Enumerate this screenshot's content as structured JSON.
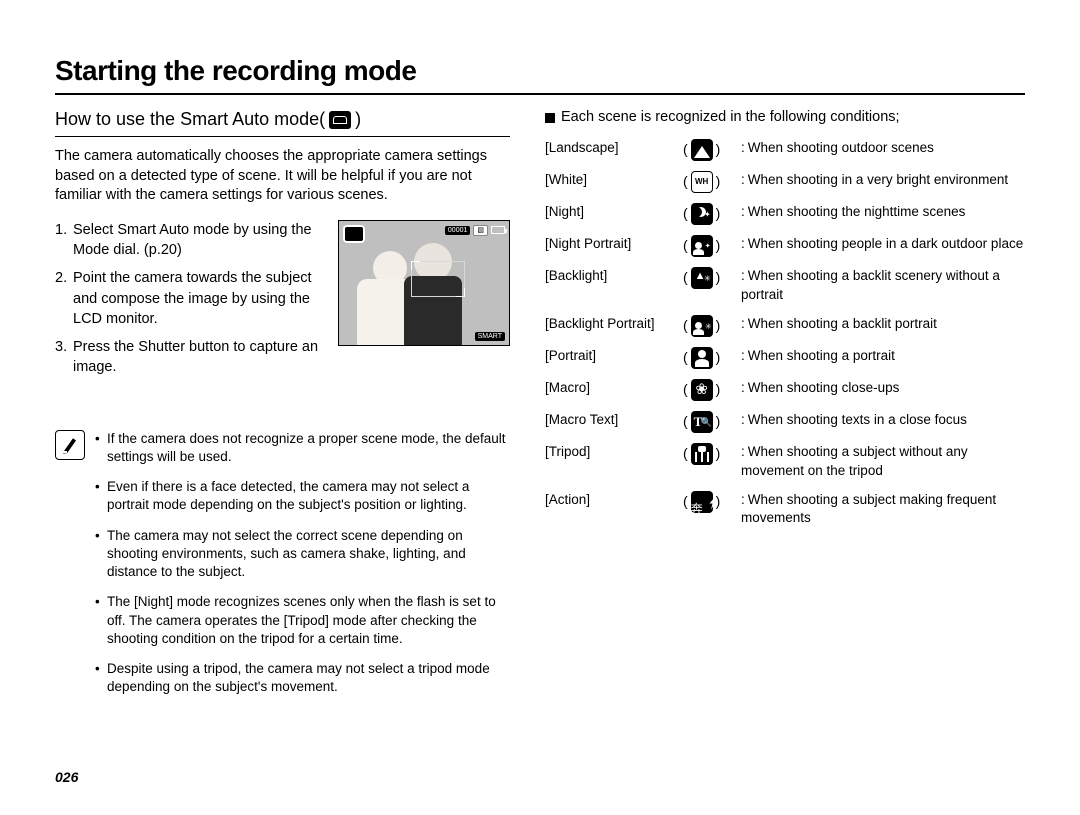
{
  "title": "Starting the recording mode",
  "page_number": "026",
  "left": {
    "subhead_prefix": "How to use the Smart Auto mode(",
    "subhead_suffix": " )",
    "intro": "The camera automatically chooses the appropriate camera settings based on a detected type of scene. It will be helpful if you are not familiar with the camera settings for various scenes.",
    "steps": [
      "Select Smart Auto mode by using the Mode dial. (p.20)",
      "Point the camera towards the subject and compose the image by using the LCD monitor.",
      "Press the Shutter button to capture an image."
    ],
    "osd": {
      "counter": "00001",
      "smart_label": "SMART"
    },
    "notes": [
      "If the camera does not recognize a proper scene mode, the default settings will be used.",
      "Even if there is a face detected, the camera may not select a portrait mode depending on the subject's position or lighting.",
      "The camera may not select the correct scene depending on shooting environments, such as camera shake, lighting, and distance to the subject.",
      "The [Night] mode recognizes scenes only when the flash is set to off. The camera operates the [Tripod] mode after checking the shooting condition on the tripod for a certain time.",
      "Despite using a tripod, the camera may not select a tripod mode depending on the subject's movement."
    ]
  },
  "right": {
    "heading": "Each scene is recognized in the following conditions;",
    "rows": [
      {
        "label": "[Landscape]",
        "icon": "landscape",
        "desc": "When shooting outdoor scenes"
      },
      {
        "label": "[White]",
        "icon": "white",
        "icon_text": "WH",
        "desc": "When shooting in a very bright environment"
      },
      {
        "label": "[Night]",
        "icon": "night",
        "desc": "When shooting the nighttime scenes"
      },
      {
        "label": "[Night Portrait]",
        "icon": "nightport",
        "desc": "When shooting people in a dark outdoor place"
      },
      {
        "label": "[Backlight]",
        "icon": "backlight",
        "desc": "When shooting a backlit scenery without a portrait"
      },
      {
        "label": "[Backlight Portrait]",
        "icon": "backport",
        "desc": "When shooting a backlit portrait"
      },
      {
        "label": "[Portrait]",
        "icon": "portrait",
        "desc": "When shooting a portrait"
      },
      {
        "label": "[Macro]",
        "icon": "macro",
        "desc": "When shooting close-ups"
      },
      {
        "label": "[Macro Text]",
        "icon": "macrotext",
        "desc": "When shooting texts in a close focus"
      },
      {
        "label": "[Tripod]",
        "icon": "tripod",
        "desc": "When shooting a subject without any movement on the tripod"
      },
      {
        "label": "[Action]",
        "icon": "action",
        "desc": "When shooting a subject making frequent movements"
      }
    ]
  }
}
